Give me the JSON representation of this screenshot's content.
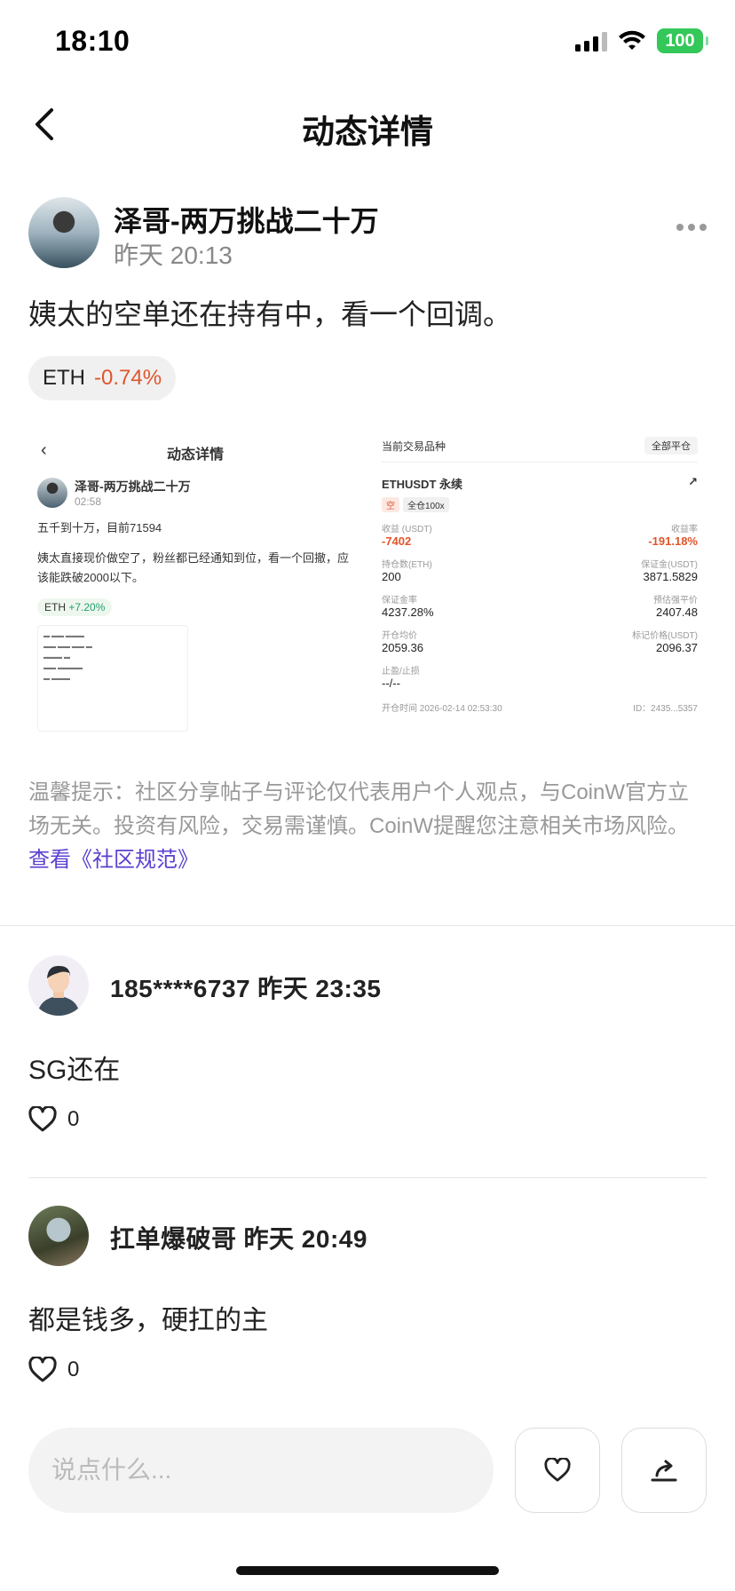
{
  "status": {
    "time": "18:10",
    "battery": "100"
  },
  "nav": {
    "title": "动态详情"
  },
  "post": {
    "author": "泽哥-两万挑战二十万",
    "time": "昨天 20:13",
    "text": "姨太的空单还在持有中，看一个回调。",
    "tag": {
      "coin": "ETH",
      "change": "-0.74%"
    },
    "image_left": {
      "title": "动态详情",
      "author": "泽哥-两万挑战二十万",
      "time": "02:58",
      "text1": "五千到十万，目前71594",
      "text2": "姨太直接现价做空了，粉丝都已经通知到位，看一个回撤，应该能跌破2000以下。",
      "tag_coin": "ETH",
      "tag_change": "+7.20%"
    },
    "image_right": {
      "top_label": "当前交易品种",
      "top_btn": "全部平仓",
      "symbol": "ETHUSDT 永续",
      "badge1": "空",
      "badge2": "全仓100x",
      "rows": [
        {
          "k": "收益 (USDT)",
          "v": "-7402"
        },
        {
          "k": "收益率",
          "v": "-191.18%"
        },
        {
          "k": "持仓数(ETH)",
          "v": "200"
        },
        {
          "k": "保证金(USDT)",
          "v": "3871.5829"
        },
        {
          "k": "保证金率",
          "v": "4237.28%"
        },
        {
          "k": "预估强平价",
          "v": "2407.48"
        },
        {
          "k": "开仓均价",
          "v": "2059.36"
        },
        {
          "k": "标记价格(USDT)",
          "v": "2096.37"
        },
        {
          "k": "止盈/止损",
          "v": "--/--"
        }
      ],
      "open_time": "开仓时间 2026-02-14 02:53:30",
      "id": "ID：2435...5357"
    }
  },
  "disclaimer": {
    "text": "温馨提示：社区分享帖子与评论仅代表用户个人观点，与CoinW官方立场无关。投资有风险，交易需谨慎。CoinW提醒您注意相关市场风险。",
    "link": "查看《社区规范》"
  },
  "comments": [
    {
      "user": "185****6737",
      "time": "昨天 23:35",
      "text": "SG还在",
      "likes": "0"
    },
    {
      "user": "扛单爆破哥",
      "time": "昨天 20:49",
      "text": "都是钱多，硬扛的主",
      "likes": "0"
    }
  ],
  "input": {
    "placeholder": "说点什么..."
  },
  "icons": {
    "back": "chevron-left-icon",
    "more": "more-dots-icon",
    "like": "heart-icon",
    "share": "share-icon"
  }
}
